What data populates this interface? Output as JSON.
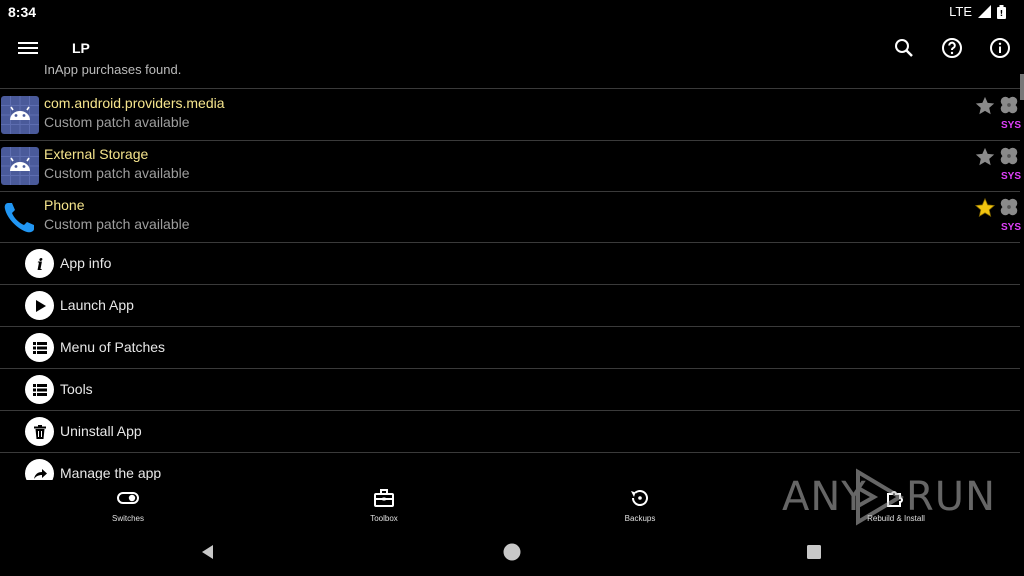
{
  "status_bar": {
    "time": "8:34",
    "network": "LTE"
  },
  "app_bar": {
    "title": "LP",
    "actions": [
      "search-icon",
      "help-icon",
      "info-icon"
    ]
  },
  "list": {
    "partial_text": "InApp purchases found.",
    "apps": [
      {
        "name": "com.android.providers.media",
        "subtitle": "Custom patch available",
        "starred": false,
        "badge": "SYS",
        "icon": "android-icon"
      },
      {
        "name": "External Storage",
        "subtitle": "Custom patch available",
        "starred": false,
        "badge": "SYS",
        "icon": "android-icon"
      },
      {
        "name": "Phone",
        "subtitle": "Custom patch available",
        "starred": true,
        "badge": "SYS",
        "icon": "phone-icon"
      }
    ],
    "context_menu": [
      {
        "label": "App info",
        "icon": "info-icon"
      },
      {
        "label": "Launch App",
        "icon": "play-icon"
      },
      {
        "label": "Menu of Patches",
        "icon": "list-icon"
      },
      {
        "label": "Tools",
        "icon": "list-icon"
      },
      {
        "label": "Uninstall App",
        "icon": "trash-icon"
      },
      {
        "label": "Manage the app",
        "icon": "share-icon"
      }
    ]
  },
  "bottom_nav": [
    {
      "label": "Switches",
      "icon": "toggle-icon"
    },
    {
      "label": "Toolbox",
      "icon": "toolbox-icon"
    },
    {
      "label": "Backups",
      "icon": "backup-icon"
    },
    {
      "label": "Rebuild & Install",
      "icon": "puzzle-icon"
    }
  ],
  "watermark": {
    "left": "ANY",
    "right": "RUN"
  },
  "colors": {
    "app_name": "#f6e58d",
    "subtitle": "#9e9e9e",
    "sys_badge": "#e040fb",
    "star_active": "#f1c40f",
    "star_inactive": "#8a8a8a",
    "android_tile": "#4a5a9a",
    "phone": "#2196f3"
  }
}
